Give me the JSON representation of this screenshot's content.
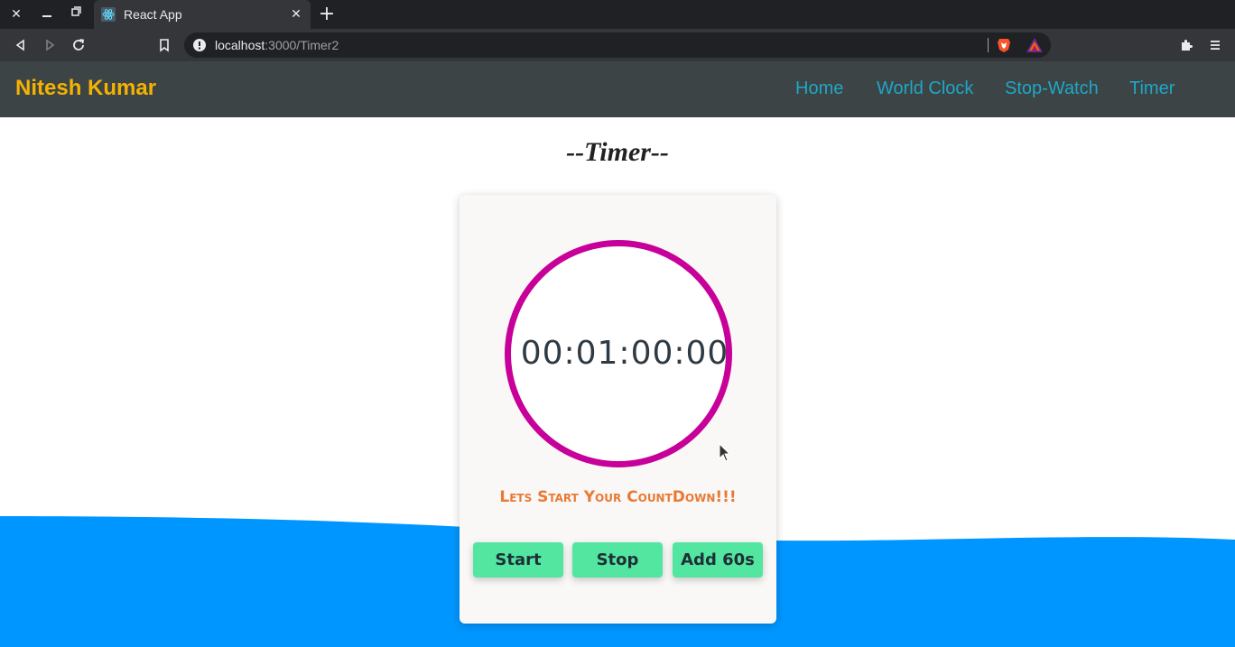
{
  "browser": {
    "tab_title": "React App",
    "url_host": "localhost",
    "url_path": ":3000/Timer2"
  },
  "navbar": {
    "brand": "Nitesh Kumar",
    "links": [
      "Home",
      "World Clock",
      "Stop-Watch",
      "Timer"
    ]
  },
  "page": {
    "title": "--Timer--"
  },
  "timer": {
    "display": "00:01:00:00",
    "message": "Lets Start Your CountDown!!!",
    "buttons": [
      "Start",
      "Stop",
      "Add 60s"
    ]
  },
  "colors": {
    "brand": "#f5b301",
    "nav_link": "#1ea7c7",
    "ring": "#c8009a",
    "button": "#52e6a0",
    "wave": "#0096ff",
    "message": "#e87a35"
  }
}
